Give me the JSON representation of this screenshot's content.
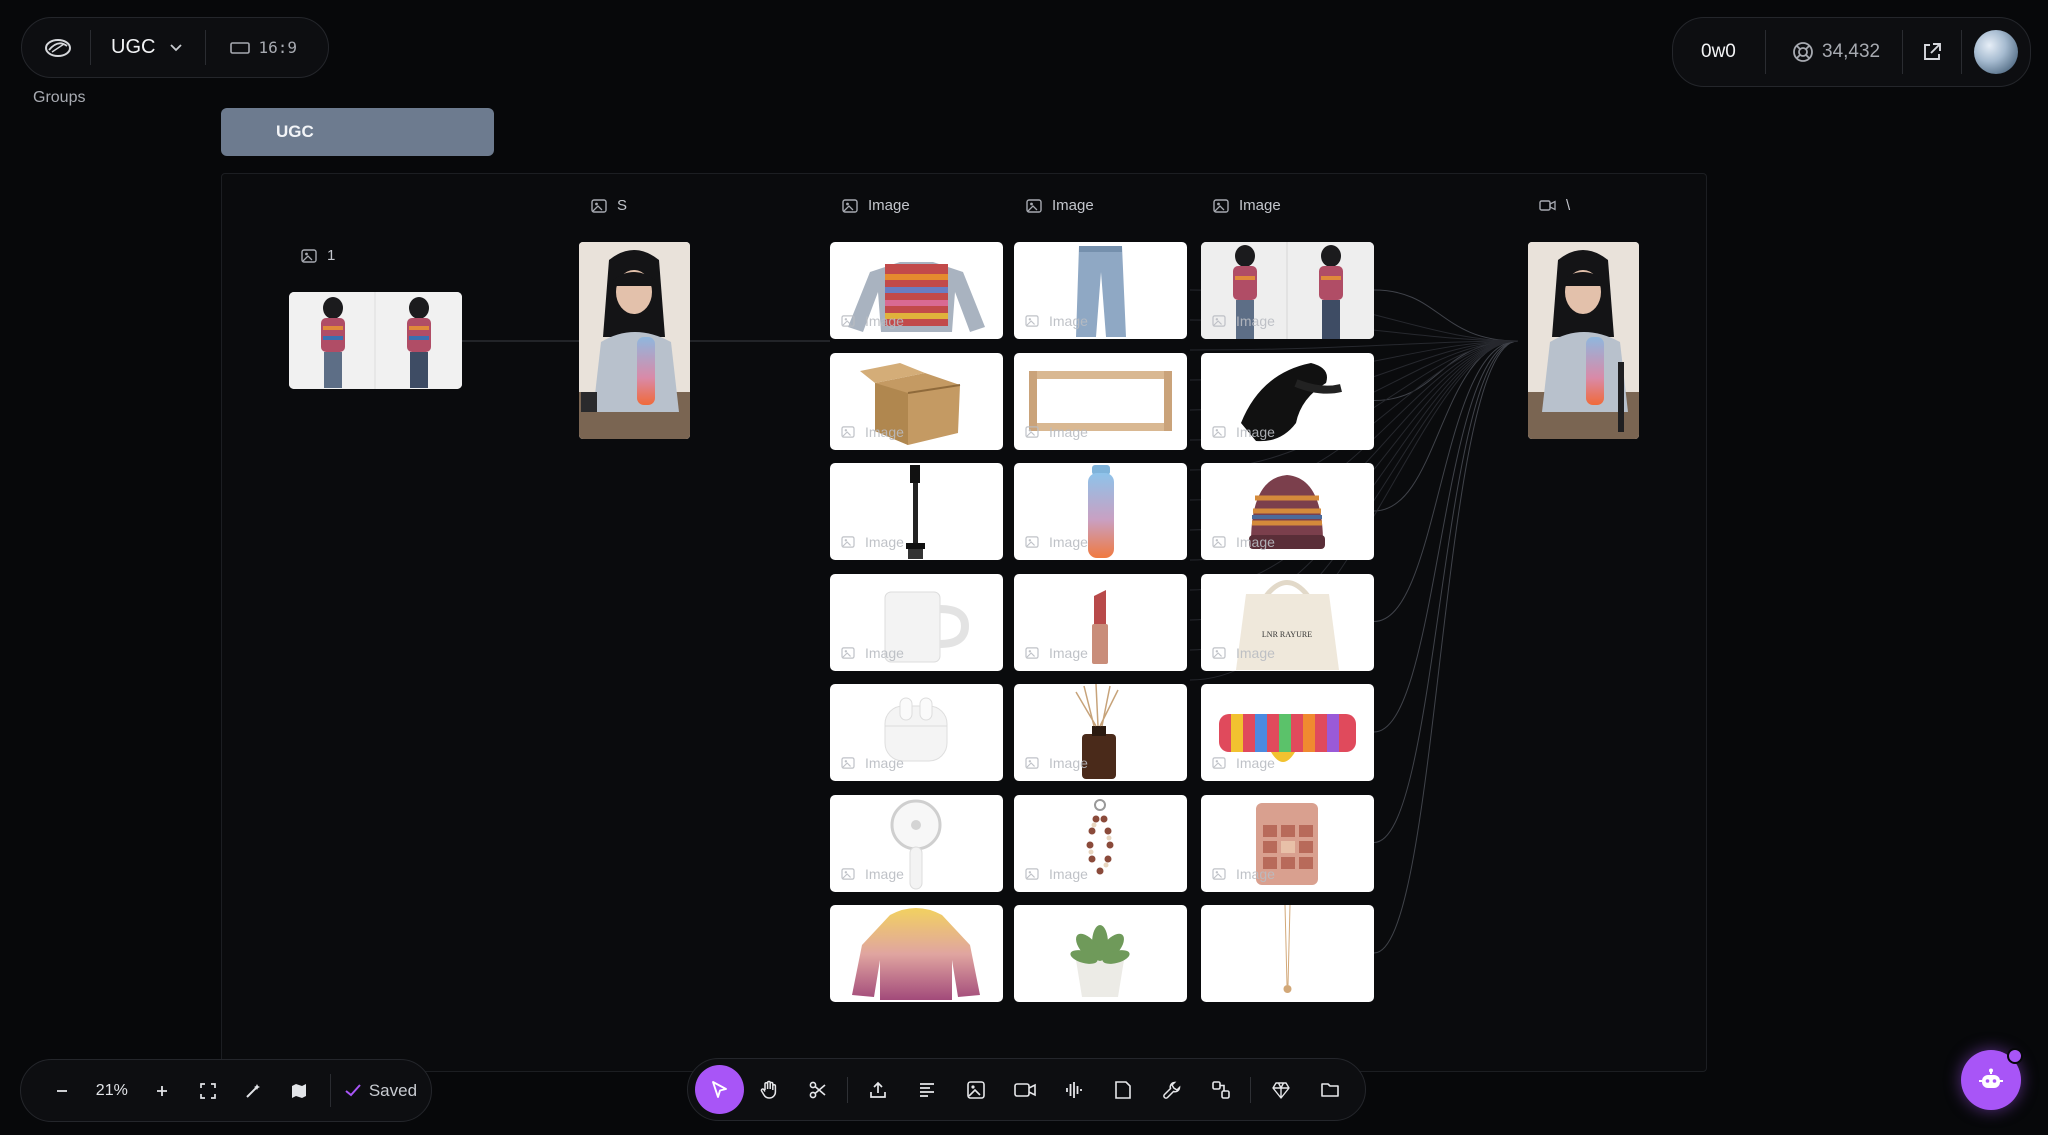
{
  "header": {
    "project_name": "UGC",
    "aspect_ratio": "16:9",
    "groups_label": "Groups",
    "logo_icon": "brand-logo-icon"
  },
  "account": {
    "username": "0w0",
    "credits": "34,432",
    "credits_icon": "lifebuoy-icon",
    "share_icon": "external-link-icon"
  },
  "group": {
    "name": "UGC"
  },
  "nodes": {
    "ref_image_label": "1",
    "person_image_label": "S",
    "video_label": "\\",
    "column_labels": [
      "Image",
      "Image",
      "Image"
    ],
    "tile_watermark": "Image"
  },
  "product_tiles": [
    [
      "striped-crop-top",
      "jeans",
      "two-model-photo"
    ],
    [
      "cardboard-box",
      "wooden-shelf",
      "hair-clip"
    ],
    [
      "phone-stand",
      "gradient-water-bottle",
      "knit-beanie"
    ],
    [
      "white-mug",
      "lipstick",
      "canvas-tote"
    ],
    [
      "earbuds-case",
      "reed-diffuser",
      "striped-socks"
    ],
    [
      "handheld-fan",
      "beaded-phone-strap",
      "eyeshadow-palette"
    ],
    [
      "ombre-hoodie",
      "succulent-pot",
      "pendant-necklace"
    ]
  ],
  "tote_text": "LNR RAYURE",
  "zoom": {
    "value": "21%",
    "status": "Saved"
  },
  "toolbar": {
    "tools": [
      "select",
      "hand",
      "scissors",
      "upload",
      "text",
      "image",
      "video",
      "audio",
      "note",
      "wrench",
      "connect",
      "gem",
      "folder"
    ],
    "active_tool": "select"
  },
  "colors": {
    "accent": "#a855f7",
    "group_tab": "#6d7b8f",
    "background": "#07080a"
  }
}
